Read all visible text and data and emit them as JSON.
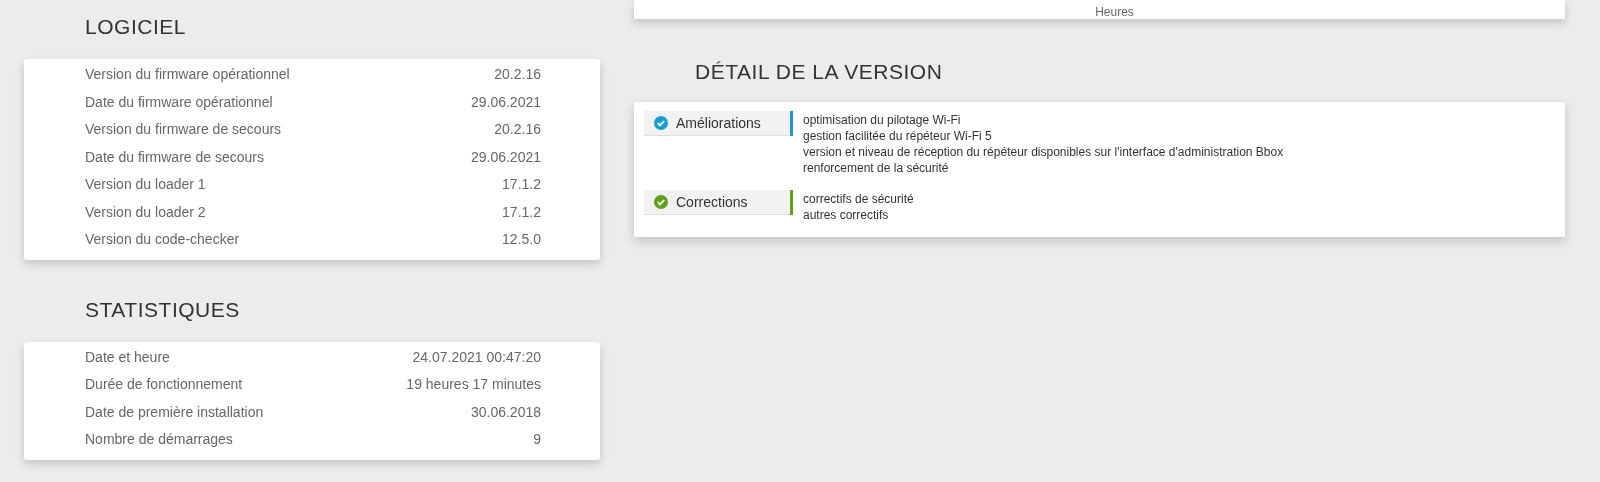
{
  "logiciel": {
    "title": "LOGICIEL",
    "rows": [
      {
        "label": "Version du firmware opérationnel",
        "value": "20.2.16"
      },
      {
        "label": "Date du firmware opérationnel",
        "value": "29.06.2021"
      },
      {
        "label": "Version du firmware de secours",
        "value": "20.2.16"
      },
      {
        "label": "Date du firmware de secours",
        "value": "29.06.2021"
      },
      {
        "label": "Version du loader 1",
        "value": "17.1.2"
      },
      {
        "label": "Version du loader 2",
        "value": "17.1.2"
      },
      {
        "label": "Version du code-checker",
        "value": "12.5.0"
      }
    ]
  },
  "statistiques": {
    "title": "STATISTIQUES",
    "rows": [
      {
        "label": "Date et heure",
        "value": "24.07.2021 00:47:20"
      },
      {
        "label": "Durée de fonctionnement",
        "value": "19 heures 17 minutes"
      },
      {
        "label": "Date de première installation",
        "value": "30.06.2018"
      },
      {
        "label": "Nombre de démarrages",
        "value": "9"
      }
    ]
  },
  "top_card": {
    "text": "Heures"
  },
  "detail": {
    "title": "DÉTAIL DE LA VERSION",
    "sections": [
      {
        "label": "Améliorations",
        "color": "#1a9bd0",
        "lines": [
          "optimisation du pilotage Wi-Fi",
          "gestion facilitée du répéteur Wi-Fi 5",
          "version et niveau de réception du répéteur disponibles sur l'interface d'administration Bbox",
          "renforcement de la sécurité"
        ]
      },
      {
        "label": "Corrections",
        "color": "#5fa31a",
        "lines": [
          "correctifs de sécurité",
          "autres correctifs"
        ]
      }
    ]
  }
}
